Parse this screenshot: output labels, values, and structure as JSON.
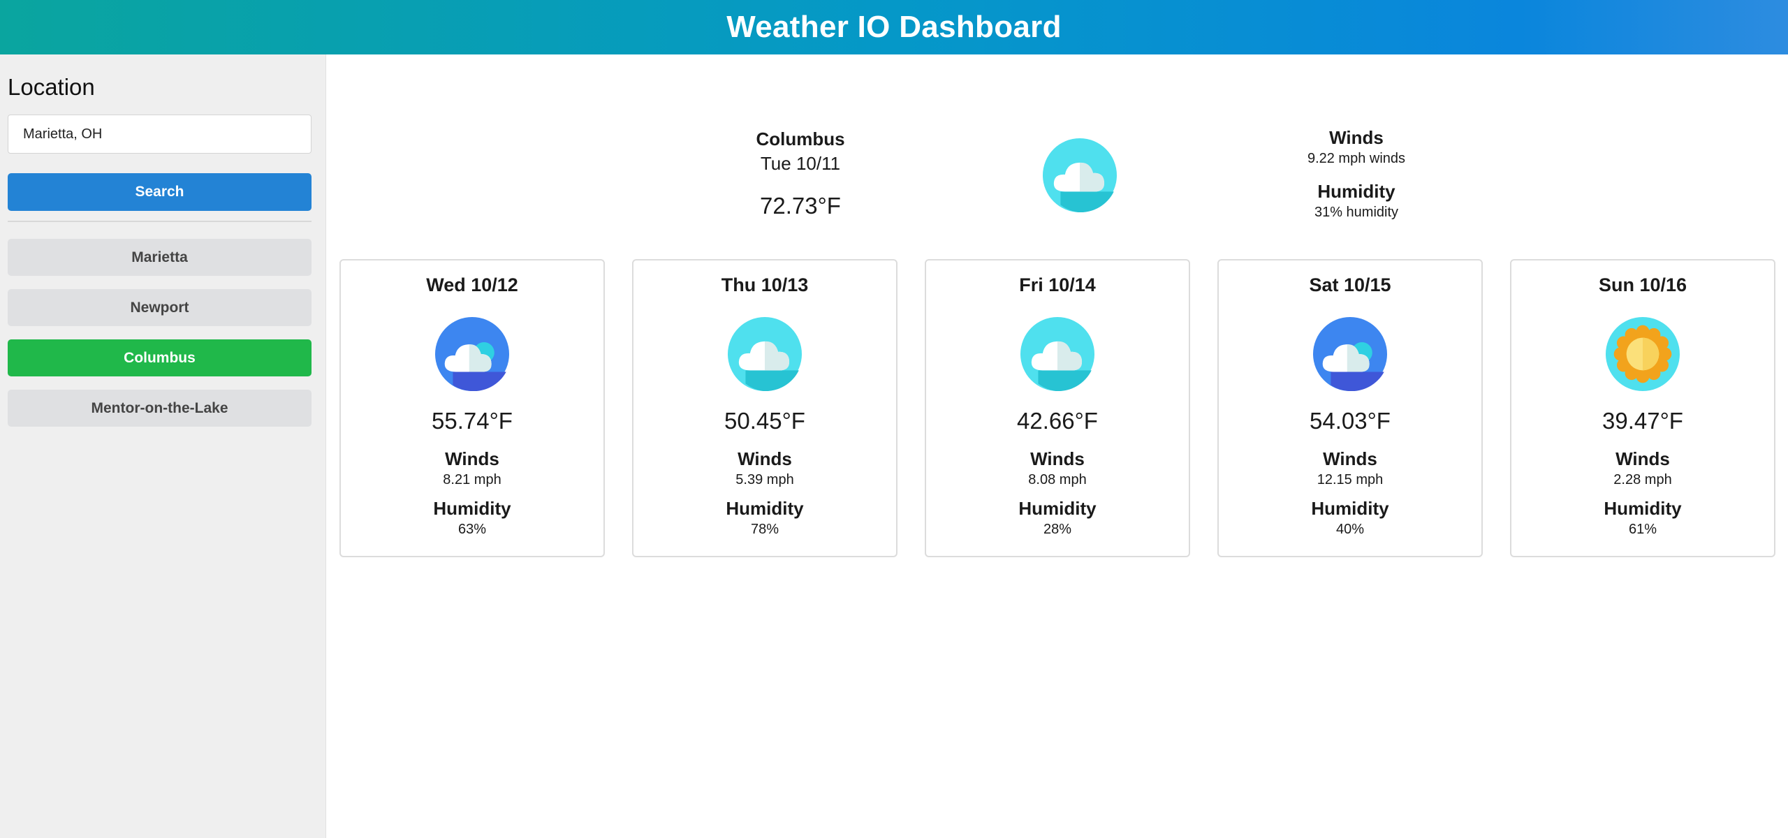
{
  "header": {
    "title": "Weather IO Dashboard"
  },
  "sidebar": {
    "heading": "Location",
    "search": {
      "value": "Marietta, OH",
      "button_label": "Search"
    },
    "cities": [
      {
        "label": "Marietta",
        "active": false
      },
      {
        "label": "Newport",
        "active": false
      },
      {
        "label": "Columbus",
        "active": true
      },
      {
        "label": "Mentor-on-the-Lake",
        "active": false
      }
    ]
  },
  "current": {
    "city": "Columbus",
    "date": "Tue 10/11",
    "temp": "72.73°F",
    "icon": "cloud-icon",
    "winds_label": "Winds",
    "winds": "9.22 mph winds",
    "humidity_label": "Humidity",
    "humidity": "31% humidity"
  },
  "forecast": [
    {
      "date": "Wed 10/12",
      "icon": "cloud-blue-icon",
      "temp": "55.74°F",
      "winds_label": "Winds",
      "winds": "8.21 mph",
      "humidity_label": "Humidity",
      "humidity": "63%"
    },
    {
      "date": "Thu 10/13",
      "icon": "cloud-icon",
      "temp": "50.45°F",
      "winds_label": "Winds",
      "winds": "5.39 mph",
      "humidity_label": "Humidity",
      "humidity": "78%"
    },
    {
      "date": "Fri 10/14",
      "icon": "cloud-icon",
      "temp": "42.66°F",
      "winds_label": "Winds",
      "winds": "8.08 mph",
      "humidity_label": "Humidity",
      "humidity": "28%"
    },
    {
      "date": "Sat 10/15",
      "icon": "cloud-blue-icon",
      "temp": "54.03°F",
      "winds_label": "Winds",
      "winds": "12.15 mph",
      "humidity_label": "Humidity",
      "humidity": "40%"
    },
    {
      "date": "Sun 10/16",
      "icon": "sun-icon",
      "temp": "39.47°F",
      "winds_label": "Winds",
      "winds": "2.28 mph",
      "humidity_label": "Humidity",
      "humidity": "61%"
    }
  ],
  "colors": {
    "header_start": "#0aa59f",
    "header_end": "#2d8ce0",
    "search_button": "#2383d5",
    "active_city": "#20b84a",
    "inactive_city": "#dfe0e2"
  }
}
